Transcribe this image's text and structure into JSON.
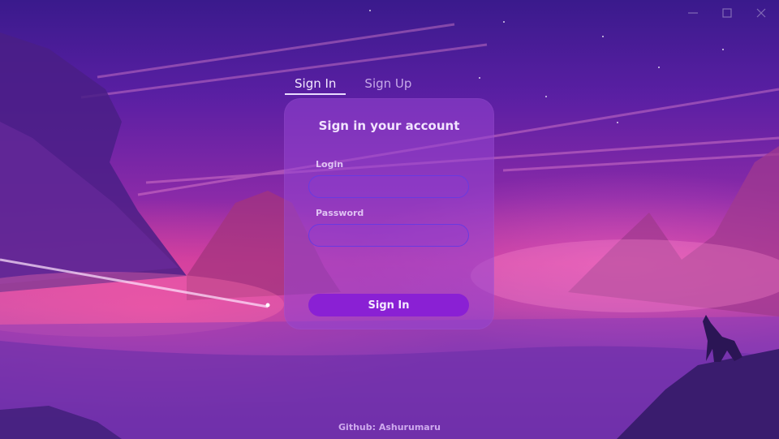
{
  "window": {
    "controls": [
      "minimize-icon",
      "maximize-icon",
      "close-icon"
    ]
  },
  "tabs": [
    {
      "label": "Sign In",
      "active": true
    },
    {
      "label": "Sign Up",
      "active": false
    }
  ],
  "form": {
    "title": "Sign in your account",
    "login_label": "Login",
    "login_value": "",
    "password_label": "Password",
    "password_value": "",
    "submit_label": "Sign In"
  },
  "footer": {
    "text": "Github: Ashurumaru"
  },
  "colors": {
    "accent": "#8a20d4",
    "field_border": "#6a3ae0",
    "sky_top": "#3a1a8c",
    "glow_pink": "#c33a9e"
  }
}
